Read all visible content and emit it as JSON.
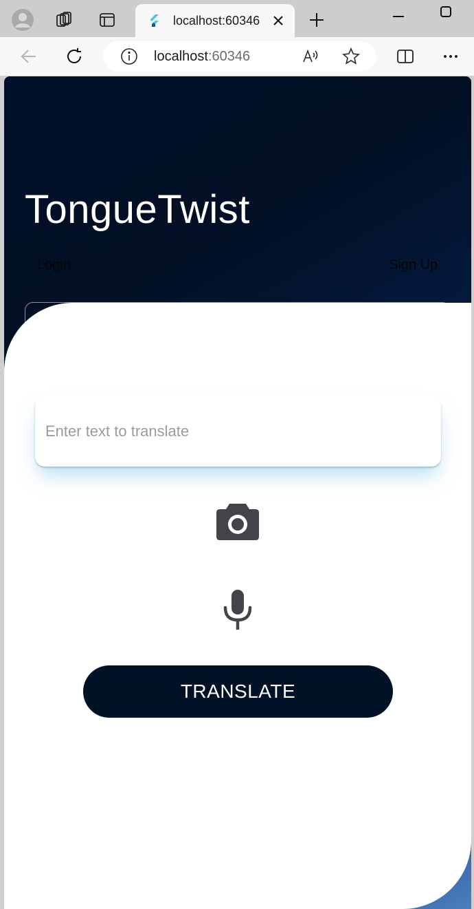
{
  "browser": {
    "tab_title": "localhost:60346",
    "url_host": "localhost",
    "url_port": ":60346"
  },
  "app": {
    "title": "TongueTwist",
    "nav": {
      "login_label": "Login",
      "signup_label": "Sign Up"
    },
    "input": {
      "placeholder": "Enter text to translate",
      "value": ""
    },
    "translate_label": "TRANSLATE"
  },
  "colors": {
    "hero_dark": "#020f24",
    "hero_light": "#4c7fbf",
    "button_bg": "#011126",
    "icon_color": "#45434a"
  },
  "icons": {
    "camera": "camera-icon",
    "microphone": "microphone-icon"
  }
}
